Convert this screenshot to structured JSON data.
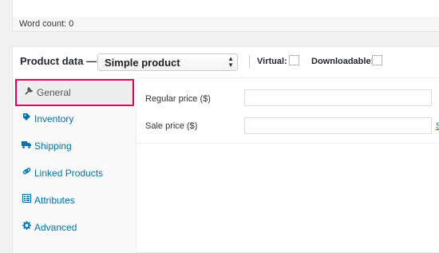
{
  "editor": {
    "word_count": "Word count: 0"
  },
  "product_data": {
    "title": "Product data —",
    "type_select": {
      "selected": "Simple product"
    },
    "virtual_label": "Virtual:",
    "downloadable_label": "Downloadable:",
    "virtual_checked": false,
    "downloadable_checked": false
  },
  "tabs": [
    {
      "label": "General",
      "icon": "wrench-icon",
      "active": true
    },
    {
      "label": "Inventory",
      "icon": "tag-icon",
      "active": false
    },
    {
      "label": "Shipping",
      "icon": "truck-icon",
      "active": false
    },
    {
      "label": "Linked Products",
      "icon": "link-icon",
      "active": false
    },
    {
      "label": "Attributes",
      "icon": "list-icon",
      "active": false
    },
    {
      "label": "Advanced",
      "icon": "gear-icon",
      "active": false
    }
  ],
  "general": {
    "regular_price_label": "Regular price ($)",
    "regular_price_value": "",
    "sale_price_label": "Sale price ($)",
    "sale_price_value": "",
    "schedule_link": "S"
  },
  "colors": {
    "highlight": "#e5005b",
    "link": "#0073aa"
  }
}
